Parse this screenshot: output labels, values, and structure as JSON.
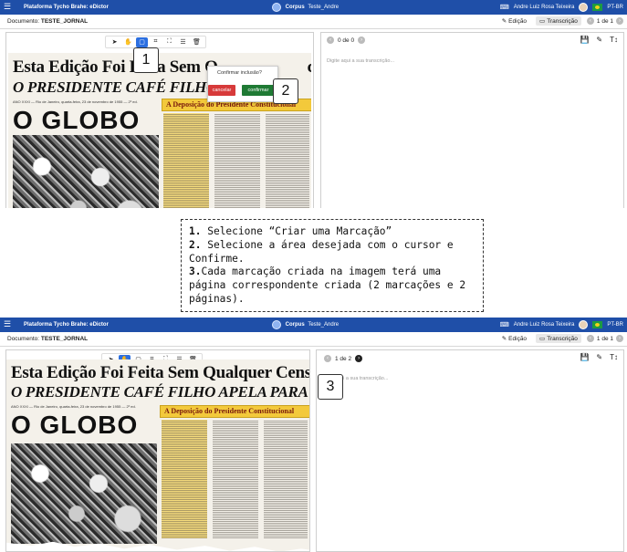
{
  "app": {
    "title": "Plataforma Tycho Brahe: eDictor",
    "corpus_label": "Corpus",
    "corpus_name": "Teste_Andre",
    "user": "Andre Luiz Rosa Teixeira",
    "lang": "PT-BR"
  },
  "doc": {
    "label": "Documento:",
    "name": "TESTE_JORNAL",
    "edit_label": "Edição",
    "transc_label": "Transcrição"
  },
  "top": {
    "page_indicator": "1 de 1",
    "rtool_count": "0 de 0",
    "placeholder": "Digite aqui a sua transcrição...",
    "confirm_question": "Confirmar inclusão?",
    "cancel_label": "cancelar",
    "confirm_label": "confirmar",
    "callout_1": "1",
    "callout_2": "2"
  },
  "bottom": {
    "page_indicator": "1 de 1",
    "rtool_count": "1 de 2",
    "placeholder": "aqui a sua transcrição...",
    "callout_3": "3"
  },
  "newspaper": {
    "headline1_top": "Esta Edição Foi Feita Sem Q",
    "headline1_top_end": "censura",
    "headline2_top": "O PRESIDENTE CAFÉ FILHO APELA",
    "headline1_bottom": "Esta Edição Foi Feita Sem Qualquer Censura",
    "headline2_bottom": "O PRESIDENTE CAFÉ FILHO APELA PARA  O SUPREMO",
    "masthead": "O GLOBO",
    "inset_title": "A Deposição do Presidente Constitucional",
    "date_strip": "ANO XXXI — Rio de Janeiro, quarta-feira, 23 de novembro de 1955 — 2º ed."
  },
  "instructions": {
    "n1": "1.",
    "t1": " Selecione “Criar uma Marcação”",
    "n2": "2.",
    "t2": " Selecione a área desejada com o cursor e Confirme.",
    "n3": "3.",
    "t3": "Cada marcação criada na imagem terá uma página correspondente criada (2 marcações e 2 páginas)."
  }
}
